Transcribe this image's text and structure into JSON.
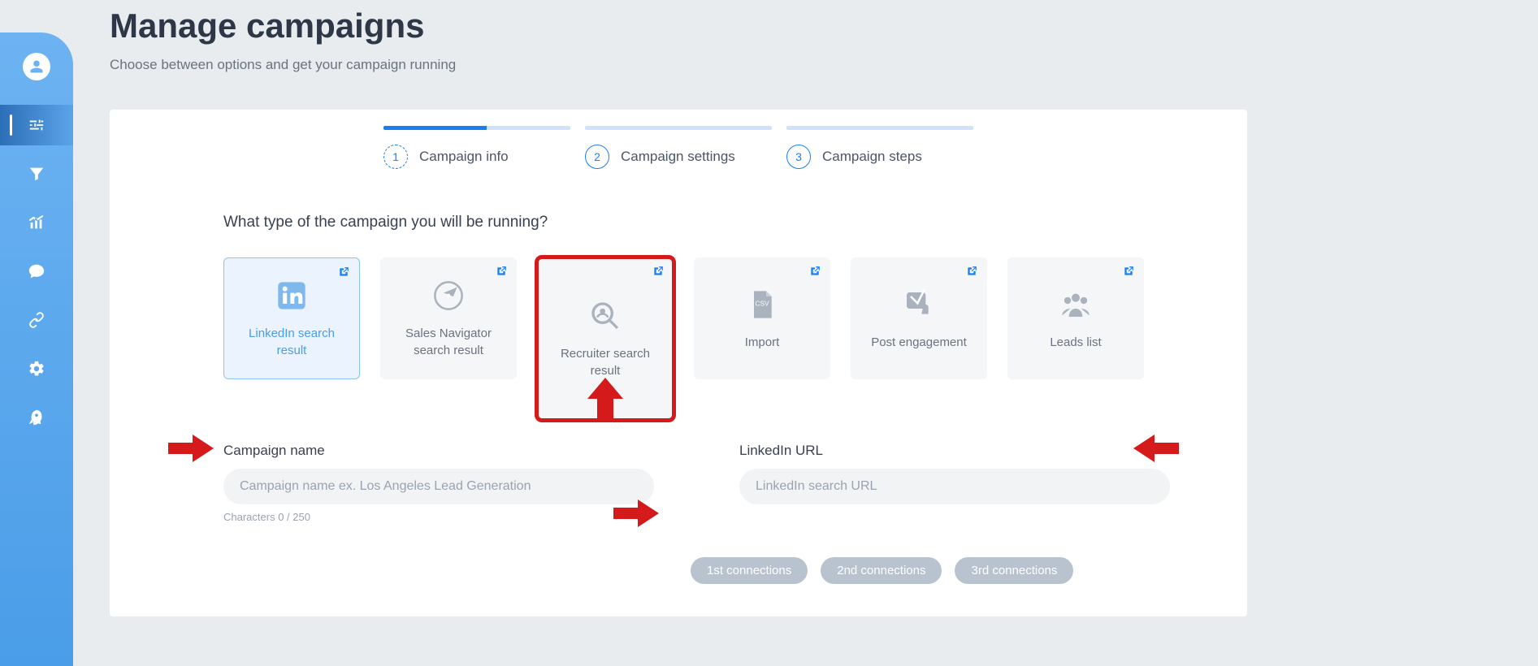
{
  "page": {
    "title": "Manage campaigns",
    "subtitle": "Choose between options and get your campaign running"
  },
  "stepper": {
    "steps": [
      {
        "num": "1",
        "label": "Campaign info"
      },
      {
        "num": "2",
        "label": "Campaign settings"
      },
      {
        "num": "3",
        "label": "Campaign steps"
      }
    ]
  },
  "section": {
    "typeHeading": "What type of the campaign you will be running?"
  },
  "types": [
    {
      "key": "linkedin",
      "label": "LinkedIn search result"
    },
    {
      "key": "salesnav",
      "label": "Sales Navigator search result"
    },
    {
      "key": "recruiter",
      "label": "Recruiter search result"
    },
    {
      "key": "import",
      "label": "Import"
    },
    {
      "key": "postengagement",
      "label": "Post engagement"
    },
    {
      "key": "leadslist",
      "label": "Leads list"
    }
  ],
  "form": {
    "campaignNameLabel": "Campaign name",
    "campaignNamePlaceholder": "Campaign name ex. Los Angeles Lead Generation",
    "campaignNameValue": "",
    "charCounter": "Characters 0 / 250",
    "linkedinUrlLabel": "LinkedIn URL",
    "linkedinUrlPlaceholder": "LinkedIn search URL",
    "linkedinUrlValue": ""
  },
  "chips": [
    "1st connections",
    "2nd connections",
    "3rd connections"
  ]
}
